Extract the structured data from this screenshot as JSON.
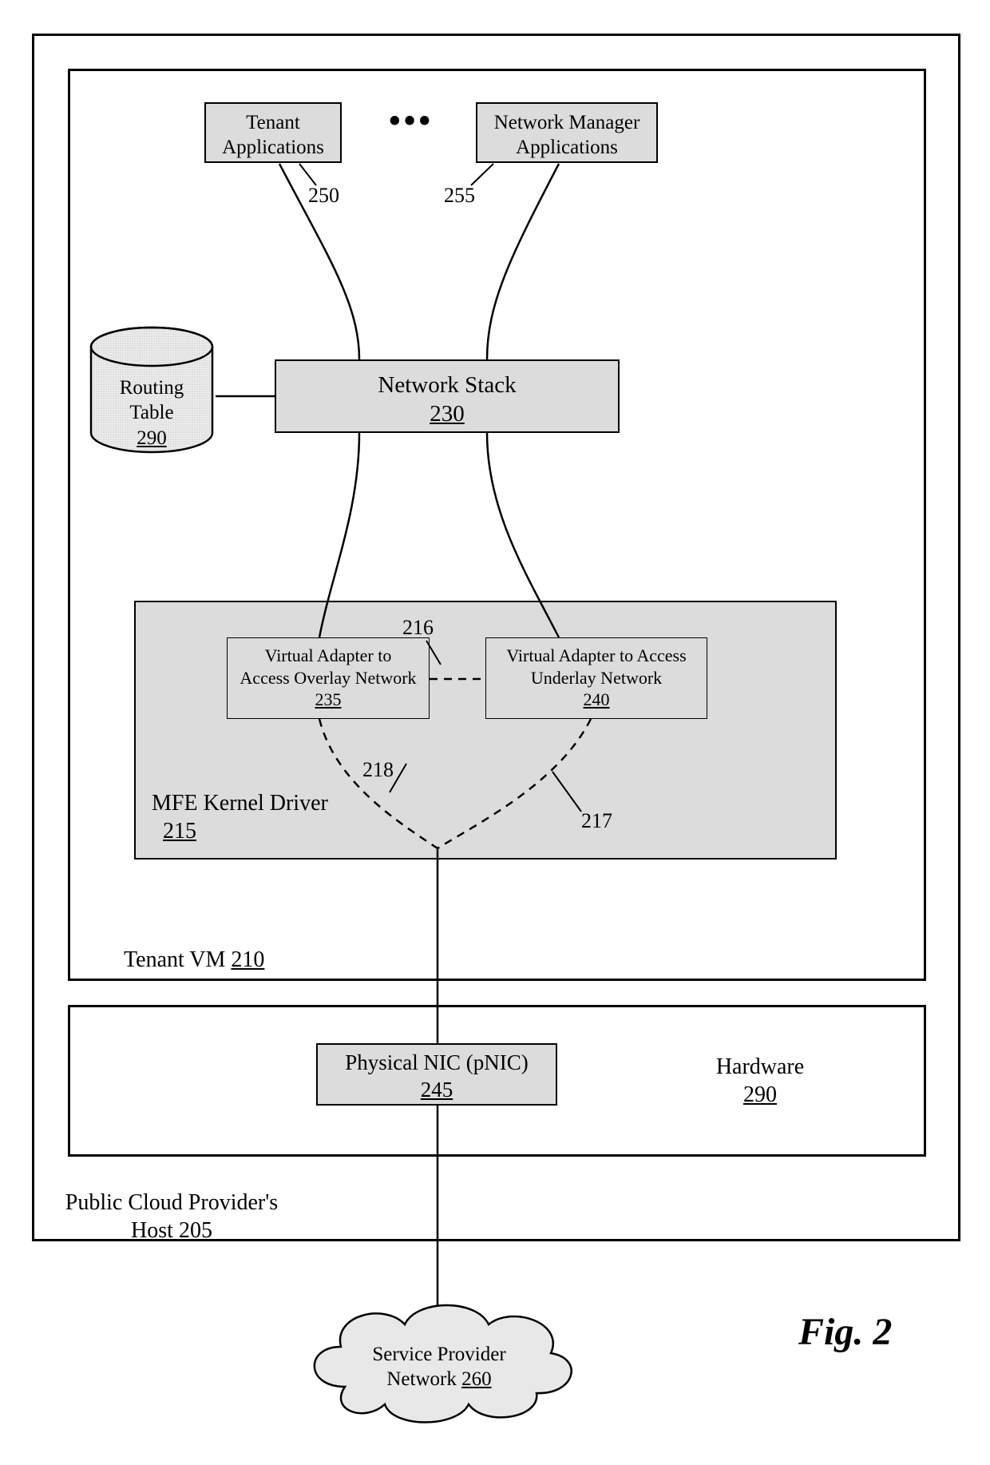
{
  "figureLabel": "Fig. 2",
  "host": {
    "label": "Public Cloud Provider's",
    "label2": "Host",
    "ref": "205"
  },
  "tenantVM": {
    "label": "Tenant VM",
    "ref": "210"
  },
  "tenantApps": {
    "label": "Tenant",
    "label2": "Applications",
    "ref": "250"
  },
  "nwMgrApps": {
    "label": "Network Manager",
    "label2": "Applications",
    "ref": "255"
  },
  "ellipsis": "•••",
  "routingTable": {
    "label": "Routing",
    "label2": "Table",
    "ref": "290"
  },
  "networkStack": {
    "label": "Network Stack",
    "ref": "230"
  },
  "mfe": {
    "label": "MFE Kernel Driver",
    "ref": "215"
  },
  "vAdapterOverlay": {
    "label": "Virtual Adapter to",
    "label2": "Access Overlay Network",
    "ref": "235"
  },
  "vAdapterUnderlay": {
    "label": "Virtual Adapter to Access",
    "label2": "Underlay Network",
    "ref": "240"
  },
  "link216": "216",
  "link217": "217",
  "link218": "218",
  "hardware": {
    "label": "Hardware",
    "ref": "290"
  },
  "pnic": {
    "label": "Physical NIC (pNIC)",
    "ref": "245"
  },
  "spNetwork": {
    "label": "Service Provider",
    "label2": "Network",
    "ref": "260"
  }
}
